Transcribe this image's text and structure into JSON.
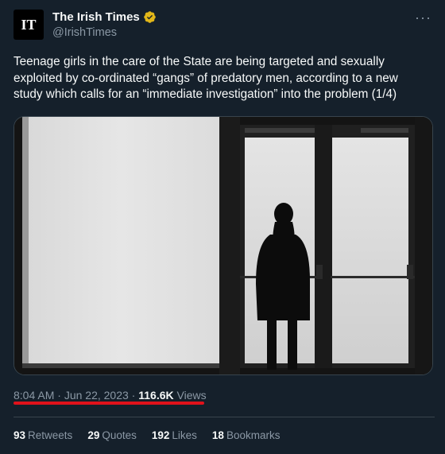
{
  "author": {
    "avatar_text": "IT",
    "display_name": "The Irish Times",
    "handle": "@IrishTimes",
    "verified_color": "#e2b719"
  },
  "more_label": "···",
  "tweet": {
    "text_lines": [
      "Teenage girls in the care of the State are being targeted and sexually",
      "exploited by co-ordinated “gangs” of predatory men, according to a new",
      "study which calls for an “immediate investigation” into the problem (1/4)"
    ]
  },
  "meta": {
    "time": "8:04 AM",
    "sep1": " · ",
    "date": "Jun 22, 2023",
    "sep2": " · ",
    "views_count": "116.6K",
    "views_label": " Views"
  },
  "stats": {
    "retweets_count": "93",
    "retweets_label": "Retweets",
    "quotes_count": "29",
    "quotes_label": "Quotes",
    "likes_count": "192",
    "likes_label": "Likes",
    "bookmarks_count": "18",
    "bookmarks_label": "Bookmarks"
  },
  "colors": {
    "background": "#15202b",
    "secondary_text": "#8b98a5",
    "highlight_underline": "#e0121b"
  }
}
